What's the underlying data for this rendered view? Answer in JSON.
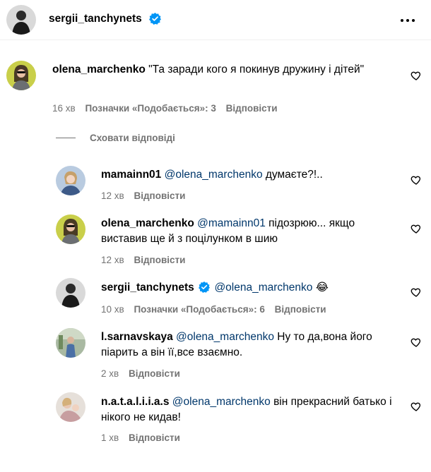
{
  "header": {
    "username": "sergii_tanchynets",
    "verified": true,
    "more_icon": "more-horizontal-icon"
  },
  "main_comment": {
    "username": "olena_marchenko",
    "text": "\"Та заради кого я покинув дружину і дітей\"",
    "time": "16 хв",
    "likes": "Позначки «Подобається»: 3",
    "reply": "Відповісти"
  },
  "hide_replies": "Сховати відповіді",
  "replies": [
    {
      "username": "mamainn01",
      "mention": "@olena_marchenko",
      "text": " думаєте?!..",
      "time": "12 хв",
      "reply": "Відповісти"
    },
    {
      "username": "olena_marchenko",
      "mention": "@mamainn01",
      "text": " підозрюю... якщо виставив ще й з поцілунком в шию",
      "time": "12 хв",
      "reply": "Відповісти"
    },
    {
      "username": "sergii_tanchynets",
      "verified": true,
      "mention": "@olena_marchenko",
      "text": " 😂",
      "time": "10 хв",
      "likes": "Позначки «Подобається»: 6",
      "reply": "Відповісти"
    },
    {
      "username": "l.sarnavskaya",
      "mention": "@olena_marchenko",
      "text": " Ну то да,вона його піарить а він її,все взаємно.",
      "time": "2 хв",
      "reply": "Відповісти"
    },
    {
      "username": "n.a.t.a.l.i.i.a.s",
      "mention": "@olena_marchenko",
      "text": " він прекрасний батько і нікого не кидав!",
      "time": "1 хв",
      "reply": "Відповісти"
    }
  ],
  "colors": {
    "secondary_text": "#737373",
    "mention": "#00376b",
    "verified_badge": "#0095f6"
  }
}
